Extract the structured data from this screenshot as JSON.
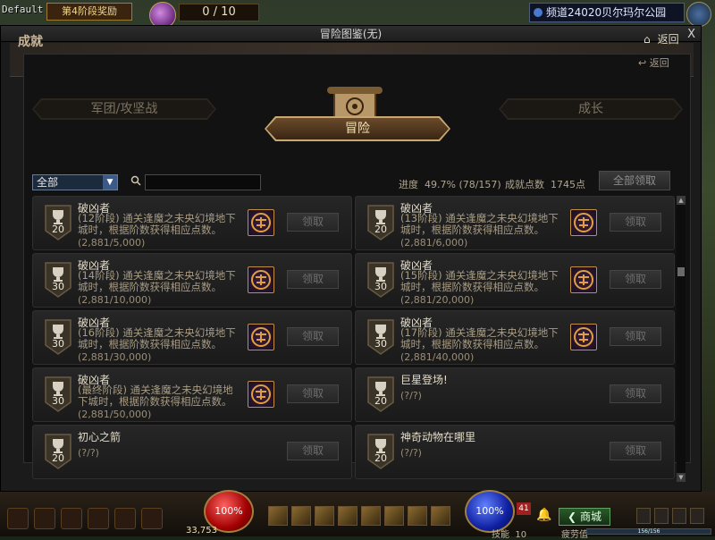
{
  "hud_top": {
    "default_label": "Default",
    "stage_label": "第4阶段奖励",
    "count": "0 / 10",
    "channel": "频道24020贝尔玛尔公园"
  },
  "window": {
    "title": "冒险图鉴(无)",
    "close": "X",
    "section_title": "成就",
    "back": "返回",
    "back_secondary": "返回"
  },
  "tabs": {
    "left": "军团/攻坚战",
    "center": "冒险",
    "right": "成长"
  },
  "filter": {
    "selected": "全部",
    "search_value": "",
    "progress_label": "进度",
    "progress_value": "49.7% (78/157)",
    "points_label": "成就点数",
    "points_value": "1745点",
    "claim_all": "全部领取"
  },
  "achievements": [
    {
      "title": "破凶者",
      "desc": "(12阶段) 通关逢魔之未央幻境地下城时，根据阶数获得相应点数。",
      "progress": "(2,881/5,000)",
      "points": "20",
      "has_reward": true,
      "claim": "领取"
    },
    {
      "title": "破凶者",
      "desc": "(13阶段) 通关逢魔之未央幻境地下城时，根据阶数获得相应点数。",
      "progress": "(2,881/6,000)",
      "points": "20",
      "has_reward": true,
      "claim": "领取"
    },
    {
      "title": "破凶者",
      "desc": "(14阶段) 通关逢魔之未央幻境地下城时，根据阶数获得相应点数。",
      "progress": "(2,881/10,000)",
      "points": "30",
      "has_reward": true,
      "claim": "领取"
    },
    {
      "title": "破凶者",
      "desc": "(15阶段) 通关逢魔之未央幻境地下城时，根据阶数获得相应点数。",
      "progress": "(2,881/20,000)",
      "points": "30",
      "has_reward": true,
      "claim": "领取"
    },
    {
      "title": "破凶者",
      "desc": "(16阶段) 通关逢魔之未央幻境地下城时，根据阶数获得相应点数。",
      "progress": "(2,881/30,000)",
      "points": "30",
      "has_reward": true,
      "claim": "领取"
    },
    {
      "title": "破凶者",
      "desc": "(17阶段) 通关逢魔之未央幻境地下城时，根据阶数获得相应点数。",
      "progress": "(2,881/40,000)",
      "points": "30",
      "has_reward": true,
      "claim": "领取"
    },
    {
      "title": "破凶者",
      "desc": "(最终阶段) 通关逢魔之未央幻境地下城时，根据阶数获得相应点数。",
      "progress": "(2,881/50,000)",
      "points": "30",
      "has_reward": true,
      "claim": "领取"
    },
    {
      "title": "巨星登场!",
      "desc": "",
      "progress": "(?/?)",
      "points": "20",
      "has_reward": false,
      "claim": "领取"
    },
    {
      "title": "初心之箭",
      "desc": "",
      "progress": "(?/?)",
      "points": "20",
      "has_reward": false,
      "claim": "领取"
    },
    {
      "title": "神奇动物在哪里",
      "desc": "",
      "progress": "(?/?)",
      "points": "20",
      "has_reward": false,
      "claim": "领取"
    }
  ],
  "hud_bottom": {
    "hp": "100%",
    "mp": "100%",
    "gold": "33,753",
    "skill_label": "技能",
    "skill_points": "10",
    "shop": "商城",
    "fatigue_label": "疲劳值",
    "fatigue_value": "156/156",
    "level_badge": "41"
  }
}
